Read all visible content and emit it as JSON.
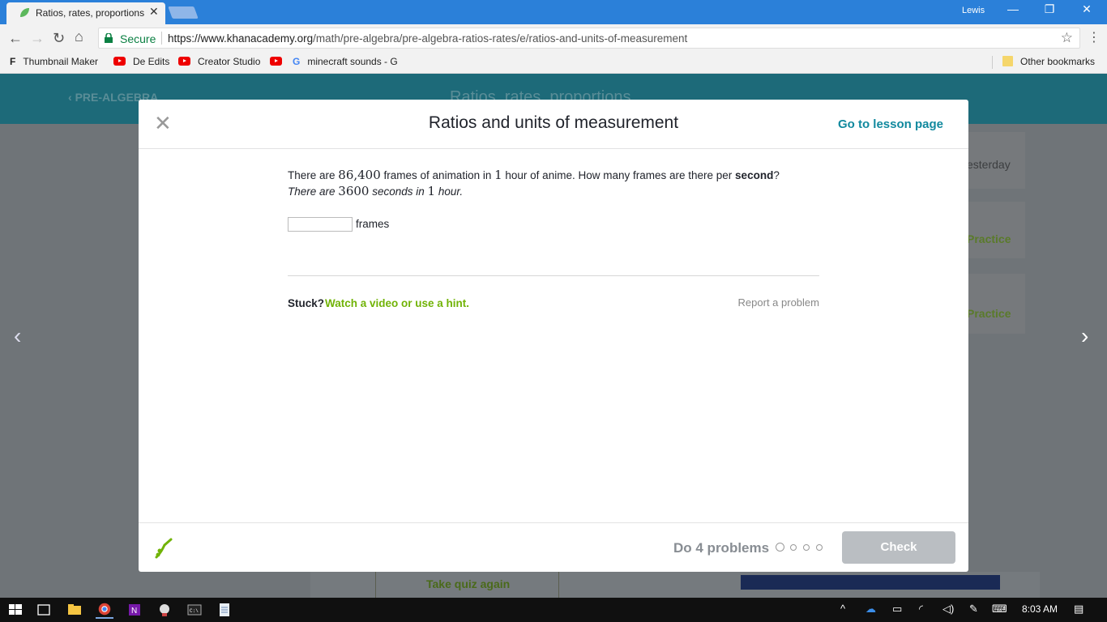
{
  "browser": {
    "tab_title": "Ratios, rates, proportions",
    "user": "Lewis",
    "secure_label": "Secure",
    "url_host": "https://www.khanacademy.org",
    "url_path": "/math/pre-algebra/pre-algebra-ratios-rates/e/ratios-and-units-of-measurement",
    "bookmarks": [
      "Thumbnail Maker",
      "De Edits",
      "Creator Studio",
      "minecraft sounds - G"
    ],
    "other_bookmarks": "Other bookmarks"
  },
  "background_page": {
    "breadcrumb": "PRE-ALGEBRA",
    "title": "Ratios, rates, proportions",
    "card_texts": [
      "esterday",
      "Practice",
      "Practice"
    ],
    "quiz_again": "Take quiz again"
  },
  "modal": {
    "title": "Ratios and units of measurement",
    "lesson_link": "Go to lesson page",
    "question": {
      "p1": "There are ",
      "n1": "86,400",
      "p2": " frames of animation in ",
      "n2": "1",
      "p3": " hour of anime. How many frames are there per ",
      "bold": "second",
      "p4": "?"
    },
    "hint_line": {
      "p1": "There are ",
      "n1": "3600",
      "p2": " seconds in ",
      "n2": "1",
      "p3": " hour."
    },
    "answer_value": "",
    "answer_unit": "frames",
    "stuck": "Stuck?",
    "hint_link": "Watch a video or use a hint.",
    "report": "Report a problem",
    "progress_label": "Do 4 problems",
    "progress_total": 4,
    "progress_done": 0,
    "check_label": "Check"
  },
  "taskbar": {
    "time": "8:03 AM"
  },
  "colors": {
    "accent_teal": "#11899e",
    "hint_green": "#71b307",
    "check_disabled": "#babec2"
  }
}
